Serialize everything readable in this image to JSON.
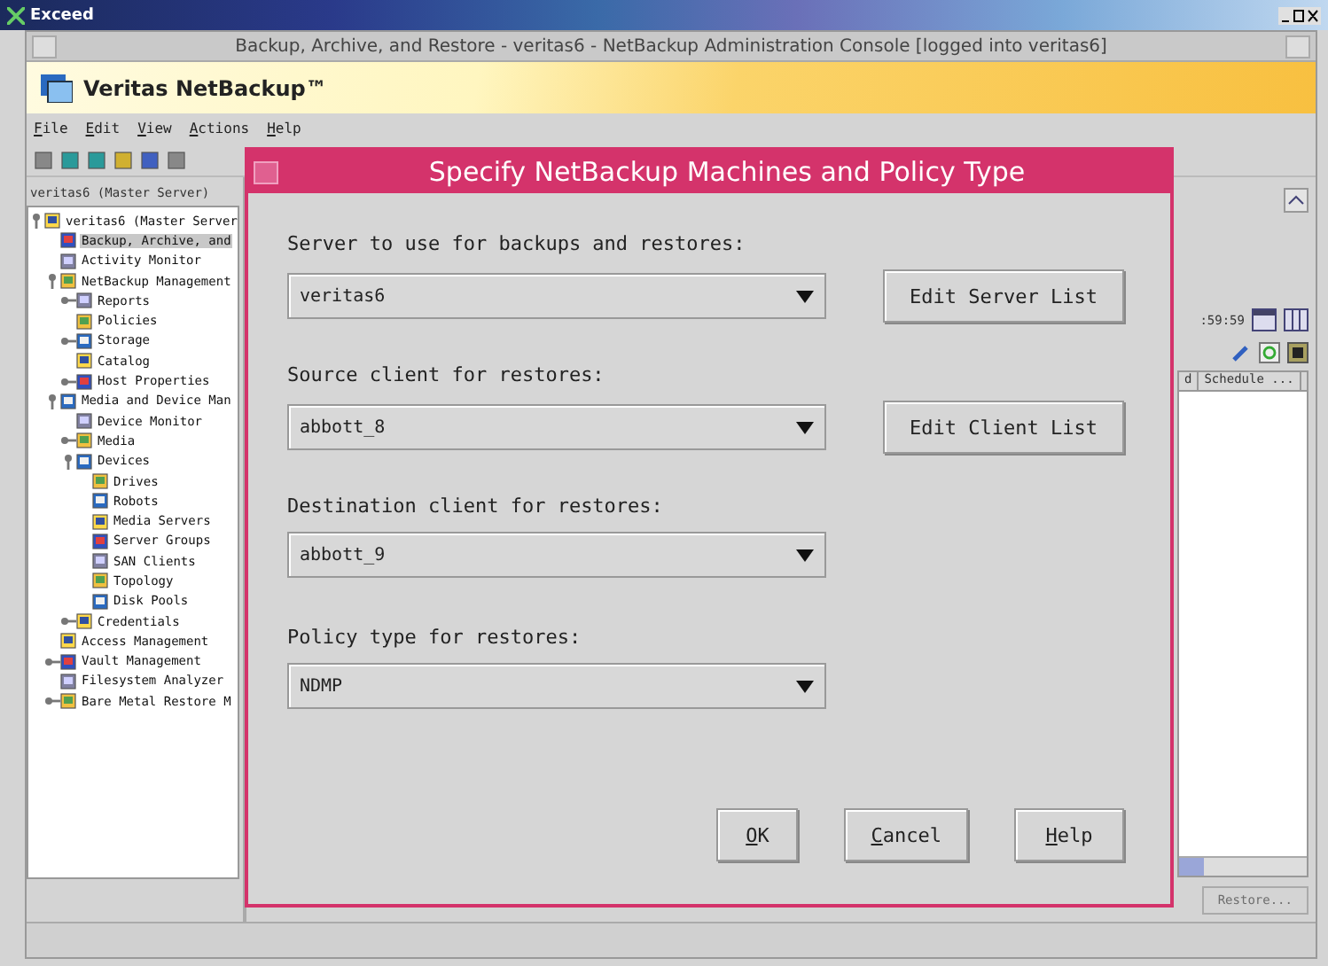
{
  "exceed_bar": {
    "title": "Exceed"
  },
  "window": {
    "title": "Backup, Archive, and Restore - veritas6 - NetBackup Administration Console [logged into veritas6]"
  },
  "banner": {
    "title": "Veritas NetBackup™"
  },
  "menu": [
    "File",
    "Edit",
    "View",
    "Actions",
    "Help"
  ],
  "tree": {
    "header": "veritas6 (Master Server)",
    "items": [
      {
        "label": "veritas6 (Master Server",
        "expanded": true,
        "selected": false,
        "children": [
          {
            "label": "Backup, Archive, and",
            "selected": true
          },
          {
            "label": "Activity Monitor",
            "selected": false
          },
          {
            "label": "NetBackup Management",
            "expanded": true,
            "selected": false,
            "children": [
              {
                "label": "Reports",
                "expanded": false,
                "selected": false
              },
              {
                "label": "Policies",
                "selected": false
              },
              {
                "label": "Storage",
                "expanded": false,
                "selected": false
              },
              {
                "label": "Catalog",
                "selected": false
              },
              {
                "label": "Host Properties",
                "expanded": false,
                "selected": false
              }
            ]
          },
          {
            "label": "Media and Device Man",
            "expanded": true,
            "selected": false,
            "children": [
              {
                "label": "Device Monitor",
                "selected": false
              },
              {
                "label": "Media",
                "expanded": false,
                "selected": false
              },
              {
                "label": "Devices",
                "expanded": true,
                "selected": false,
                "children": [
                  {
                    "label": "Drives",
                    "selected": false
                  },
                  {
                    "label": "Robots",
                    "selected": false
                  },
                  {
                    "label": "Media Servers",
                    "selected": false
                  },
                  {
                    "label": "Server Groups",
                    "selected": false
                  },
                  {
                    "label": "SAN Clients",
                    "selected": false
                  },
                  {
                    "label": "Topology",
                    "selected": false
                  },
                  {
                    "label": "Disk Pools",
                    "selected": false
                  }
                ]
              },
              {
                "label": "Credentials",
                "expanded": false,
                "selected": false
              }
            ]
          },
          {
            "label": "Access Management",
            "selected": false
          },
          {
            "label": "Vault Management",
            "expanded": false,
            "selected": false
          },
          {
            "label": "Filesystem Analyzer",
            "selected": false
          },
          {
            "label": "Bare Metal Restore M",
            "expanded": false,
            "selected": false
          }
        ]
      }
    ]
  },
  "right_panel": {
    "time_text": ":59:59",
    "columns": [
      "d",
      "Schedule ..."
    ],
    "restore_button": {
      "label": "Restore...",
      "disabled": true
    }
  },
  "dialog": {
    "title": "Specify NetBackup Machines and Policy Type",
    "fields": [
      {
        "label": "Server to use for backups and restores:",
        "value": "veritas6",
        "button": "Edit Server List"
      },
      {
        "label": "Source client for restores:",
        "value": "abbott_8",
        "button": "Edit Client List"
      },
      {
        "label": "Destination client for restores:",
        "value": "abbott_9"
      },
      {
        "label": "Policy type for restores:",
        "value": "NDMP"
      }
    ],
    "buttons": [
      "OK",
      "Cancel",
      "Help"
    ]
  }
}
